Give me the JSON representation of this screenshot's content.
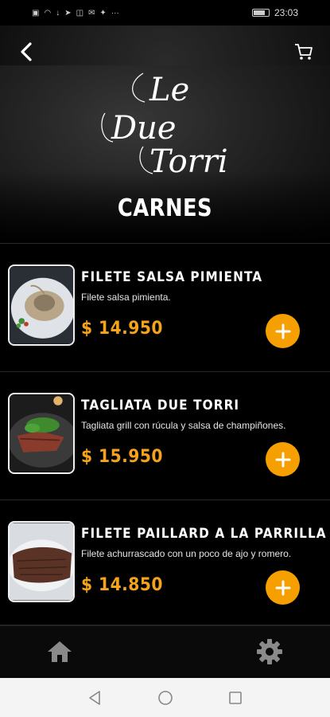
{
  "status_bar": {
    "time": "23:03",
    "left_icons": [
      "sim-icon",
      "wifi-icon",
      "download-icon",
      "telegram-icon",
      "instagram-icon",
      "mail-icon",
      "twitter-icon",
      "more-icon"
    ]
  },
  "header": {
    "logo_text": [
      "Le",
      "Due",
      "Torri"
    ],
    "title": "CARNES"
  },
  "menu": {
    "items": [
      {
        "name": "FILETE SALSA PIMIENTA",
        "description": "Filete salsa pimienta.",
        "price": "$ 14.950"
      },
      {
        "name": "TAGLIATA DUE TORRI",
        "description": "Tagliata grill con rúcula y salsa de champiñones.",
        "price": "$ 15.950"
      },
      {
        "name": "FILETE PAILLARD A LA PARRILLA",
        "description": "Filete achurrascado con un poco de ajo y romero.",
        "price": "$ 14.850"
      }
    ]
  },
  "colors": {
    "accent": "#f5a000",
    "price": "#f5a31a",
    "background": "#000000"
  }
}
